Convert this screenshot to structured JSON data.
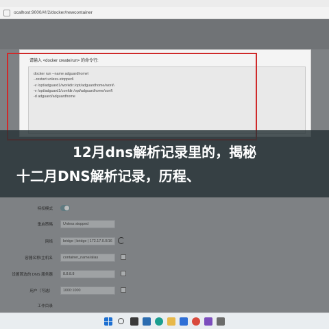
{
  "browser": {
    "address": "ocalhost:9000/#!/2/docker/newcontainer"
  },
  "modal": {
    "label": "请输入 <docker create/run> 的命令行:",
    "code_lines": [
      "docker run --name adguardhome\\",
      "  --restart unless-stopped\\",
      "  -v /opt/adguard1/workdir:/opt/adguardhome/work\\",
      "  -v /opt/adguard1/confdir:/opt/adguardhome/conf\\",
      "  -d adguard/adguardhome"
    ]
  },
  "headline": {
    "line1": "12月dns解析记录里的，揭秘",
    "line2": "十二月DNS解析记录，历程、"
  },
  "form": {
    "privileged_label": "特权模式",
    "restart_label": "重启策略",
    "restart_value": "Unless stopped",
    "network_label": "网络",
    "network_value": "bridge | bridge | 172.17.0.0/16",
    "hostname_label": "容器名称/主机名",
    "hostname_value": "container_name/alias",
    "dns_label": "设置首选的 DNS 服务器",
    "dns_value": "8.8.8.8",
    "user_label": "用户（可选）",
    "user_value": "1000:1000",
    "last_label": "工作目录"
  },
  "colors": {
    "highlight_border": "#cf2a2a",
    "headline_bg": "#263236",
    "headline_text": "#ffffff"
  },
  "taskbar": {
    "icons": [
      "windows-start-icon",
      "search-icon",
      "task-view-icon",
      "widgets-icon",
      "edge-browser-icon",
      "file-explorer-icon",
      "store-icon",
      "chrome-icon",
      "app-icon",
      "app-icon"
    ]
  }
}
